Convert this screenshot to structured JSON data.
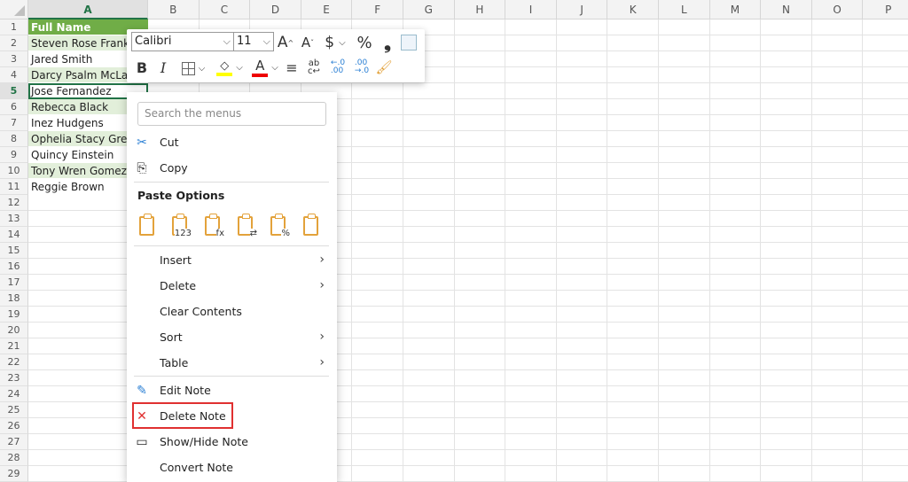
{
  "columns": [
    "A",
    "B",
    "C",
    "D",
    "E",
    "F",
    "G",
    "H",
    "I",
    "J",
    "K",
    "L",
    "M",
    "N",
    "O",
    "P"
  ],
  "rows": [
    "1",
    "2",
    "3",
    "4",
    "5",
    "6",
    "7",
    "8",
    "9",
    "10",
    "11",
    "12",
    "13",
    "14",
    "15",
    "16",
    "17",
    "18",
    "19",
    "20",
    "21",
    "22",
    "23",
    "24",
    "25",
    "26",
    "27",
    "28",
    "29"
  ],
  "column_a": [
    "Full Name",
    "Steven Rose Frank",
    "Jared  Smith",
    "Darcy Psalm McLaurin",
    "Jose  Fernandez",
    "Rebecca  Black",
    "Inez  Hudgens",
    "Ophelia Stacy Gregory",
    "Quincy  Einstein",
    "Tony Wren Gomez",
    "Reggie  Brown"
  ],
  "active_cell": "A5",
  "header_color": "#70ad47",
  "band_color": "#e2efda",
  "toolbar": {
    "font": "Calibri",
    "size": "11",
    "increase_font": "A",
    "decrease_font": "A",
    "currency": "$",
    "percent": "%",
    "comma": "❟",
    "bold": "B",
    "italic": "I",
    "font_color": "A",
    "fill_color": "#ffff00",
    "font_color_hex": "#ff0000"
  },
  "menu": {
    "search_placeholder": "Search the menus",
    "cut": "Cut",
    "copy": "Copy",
    "paste_options": "Paste Options",
    "paste_icons": [
      "paste",
      "paste-values",
      "paste-formulas",
      "paste-transpose",
      "paste-formatting",
      "paste-link"
    ],
    "paste_sub": [
      "",
      "123",
      "fx",
      "⇄",
      "%",
      ""
    ],
    "insert": "Insert",
    "delete": "Delete",
    "clear_contents": "Clear Contents",
    "sort": "Sort",
    "table": "Table",
    "edit_note": "Edit Note",
    "delete_note": "Delete Note",
    "show_hide_note": "Show/Hide Note",
    "convert_note": "Convert Note"
  }
}
